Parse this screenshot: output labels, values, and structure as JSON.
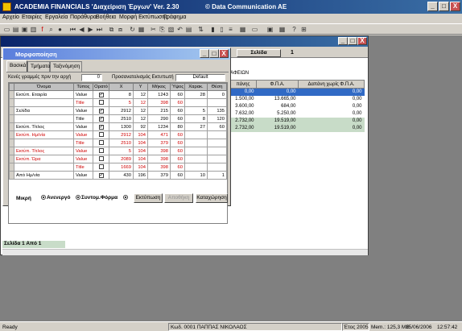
{
  "app": {
    "title": "ACADEMIA FINANCIALS 'Διαχείριση Έργων' Ver. 2.30",
    "copyright": "© Data Communication AE",
    "window_controls": [
      "_",
      "□",
      "X"
    ]
  },
  "menu": [
    "Αρχείο",
    "Εταιρίες",
    "Εργαλεία",
    "Παράθυρα",
    "Βοήθεια",
    "Μορφή Εκτύπωσης",
    "Γράφημα"
  ],
  "report": {
    "page_button": "Σελίδα",
    "page_number": "1",
    "header_fragment": "ΑΦΕΙΩΝ",
    "columns": [
      "πάνης",
      "Φ.Π.Α.",
      "Δαπάνη χωρίς Φ.Π.Α."
    ],
    "rows": [
      [
        "0,00",
        "0,00",
        "0,00"
      ],
      [
        "1.500,00",
        "13.665,00",
        "0,00"
      ],
      [
        "3.600,00",
        "684,00",
        "0,00"
      ],
      [
        "7.632,00",
        "5.250,00",
        "0,00"
      ],
      [
        "2.732,00",
        "19.519,00",
        "0,00"
      ],
      [
        "2.732,00",
        "19.519,00",
        "0,00"
      ]
    ],
    "status_line": "Σελίδα 1 Από 1"
  },
  "dialog": {
    "title": "Μορφοποίηση",
    "tabs": [
      "Βασικά",
      "Τμήματα",
      "Ταξινόμηση"
    ],
    "empty_lines_label": "Κενές γραμμές πριν την αρχή",
    "empty_lines_value": "0",
    "orientation_label": "Προσανατολισμός Εκτυπωτή",
    "orientation_value": "Default",
    "grid_columns": [
      "Όνομα",
      "Τύπος",
      "Ορατό",
      "X",
      "Y",
      "Μήκος",
      "Ύψος",
      "Χαρακ.",
      "Θέση"
    ],
    "grid_rows": [
      {
        "name": "Εκτύπ. Εταιρία",
        "type": "Value",
        "visible": true,
        "x": "8",
        "y": "12",
        "len": "1243",
        "h": "60",
        "chars": "28",
        "pos": "0",
        "red": false
      },
      {
        "name": "",
        "type": "Title",
        "visible": false,
        "x": "5",
        "y": "12",
        "len": "398",
        "h": "60",
        "chars": "",
        "pos": "",
        "red": true
      },
      {
        "name": "Σελίδα",
        "type": "Value",
        "visible": true,
        "x": "2912",
        "y": "12",
        "len": "215",
        "h": "60",
        "chars": "5",
        "pos": "135",
        "red": false
      },
      {
        "name": "",
        "type": "Title",
        "visible": true,
        "x": "2510",
        "y": "12",
        "len": "290",
        "h": "60",
        "chars": "8",
        "pos": "120",
        "red": false
      },
      {
        "name": "Εκτύπ. Τίτλος",
        "type": "Value",
        "visible": true,
        "x": "1300",
        "y": "92",
        "len": "1234",
        "h": "80",
        "chars": "27",
        "pos": "60",
        "red": false
      },
      {
        "name": "Εκτύπ. Ημ/νία",
        "type": "Value",
        "visible": false,
        "x": "2912",
        "y": "104",
        "len": "471",
        "h": "60",
        "chars": "",
        "pos": "",
        "red": true
      },
      {
        "name": "",
        "type": "Title",
        "visible": false,
        "x": "2510",
        "y": "104",
        "len": "379",
        "h": "60",
        "chars": "",
        "pos": "",
        "red": true
      },
      {
        "name": "Εκτύπ. Τίτλος",
        "type": "Value",
        "visible": false,
        "x": "5",
        "y": "104",
        "len": "398",
        "h": "60",
        "chars": "",
        "pos": "",
        "red": true
      },
      {
        "name": "Εκτύπ. Ώρα",
        "type": "Value",
        "visible": false,
        "x": "2089",
        "y": "104",
        "len": "398",
        "h": "60",
        "chars": "",
        "pos": "",
        "red": true
      },
      {
        "name": "",
        "type": "Title",
        "visible": false,
        "x": "1669",
        "y": "104",
        "len": "398",
        "h": "60",
        "chars": "",
        "pos": "",
        "red": true
      },
      {
        "name": "Από Ημ/νία",
        "type": "Value",
        "visible": true,
        "x": "430",
        "y": "196",
        "len": "379",
        "h": "60",
        "chars": "10",
        "pos": "1",
        "red": false
      }
    ],
    "bottom": {
      "label": "Μικρή",
      "radio1": "Ανενεργό",
      "radio2": "Συντομ.Φόρμα",
      "print_button": "Εκτύπωση",
      "cancel_button": "Αποθήκη",
      "save_button": "Καταχώρηση"
    }
  },
  "statusbar": {
    "ready": "Ready",
    "user": "Κωδ. 0001 ΠΑΠΠΑΣ ΝΙΚΟΛΑΟΣ",
    "year": "Έτος 2005",
    "memory": "Mem.: 125,3 MB",
    "date": "15/06/2006",
    "time": "12:57:42"
  },
  "colors": {
    "titlebar": "#0a246a",
    "red_text": "#d00000",
    "selected_row": "#316ac5",
    "total_row": "#c8dcc8"
  }
}
